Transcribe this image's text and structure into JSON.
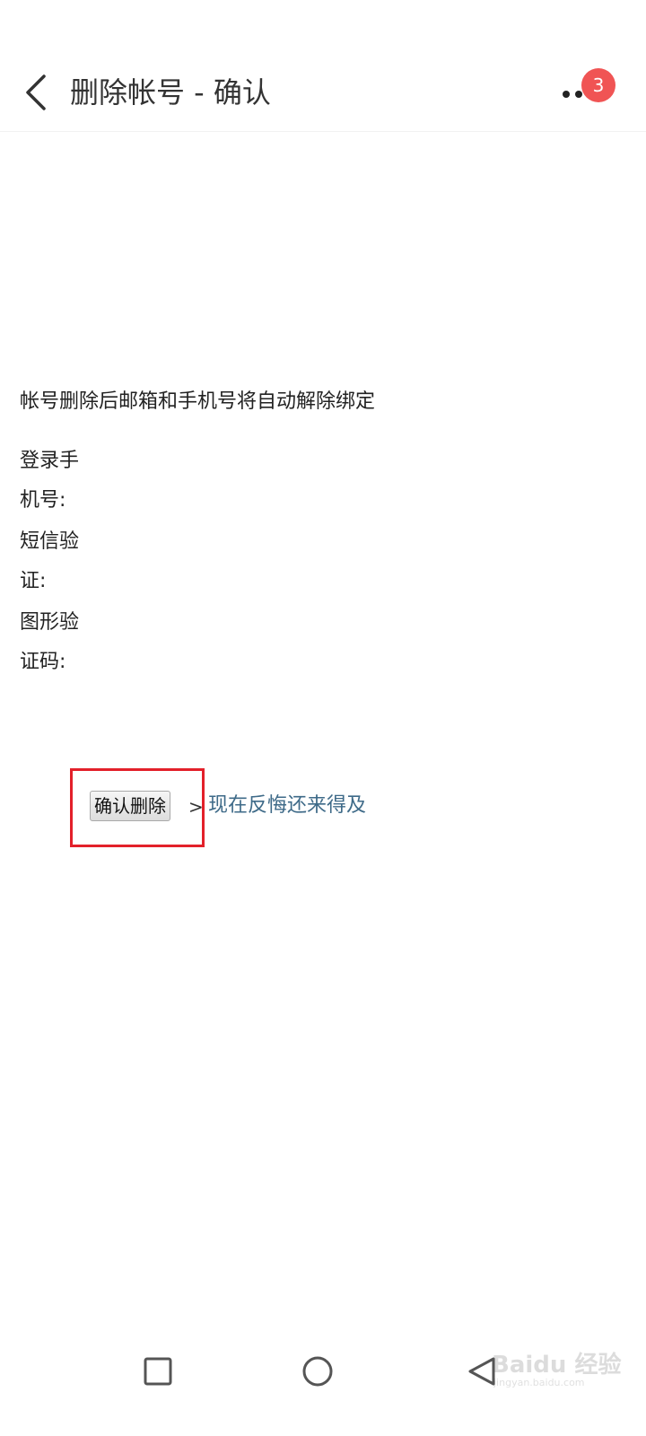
{
  "header": {
    "title": "删除帐号 - 确认",
    "back_icon": "chevron-left-icon",
    "more_icon": "more-dots-icon",
    "notification_count": "3",
    "badge_color": "#f05454"
  },
  "content": {
    "notice": "帐号删除后邮箱和手机号将自动解除绑定",
    "fields": [
      {
        "line1": "登录手",
        "line2": "机号:"
      },
      {
        "line1": "短信验",
        "line2": "证:"
      },
      {
        "line1": "图形验",
        "line2": "证码:"
      }
    ],
    "confirm_button_label": "确认删除",
    "separator": ">",
    "regret_link_text": "现在反悔还来得及",
    "highlight_color": "#e3202a",
    "link_color": "#3e6a88"
  },
  "navbar": {
    "recent_icon": "square-icon",
    "home_icon": "circle-icon",
    "back_icon": "triangle-back-icon"
  },
  "watermark": {
    "logo": "Baidu 经验",
    "sub": "jingyan.baidu.com"
  }
}
